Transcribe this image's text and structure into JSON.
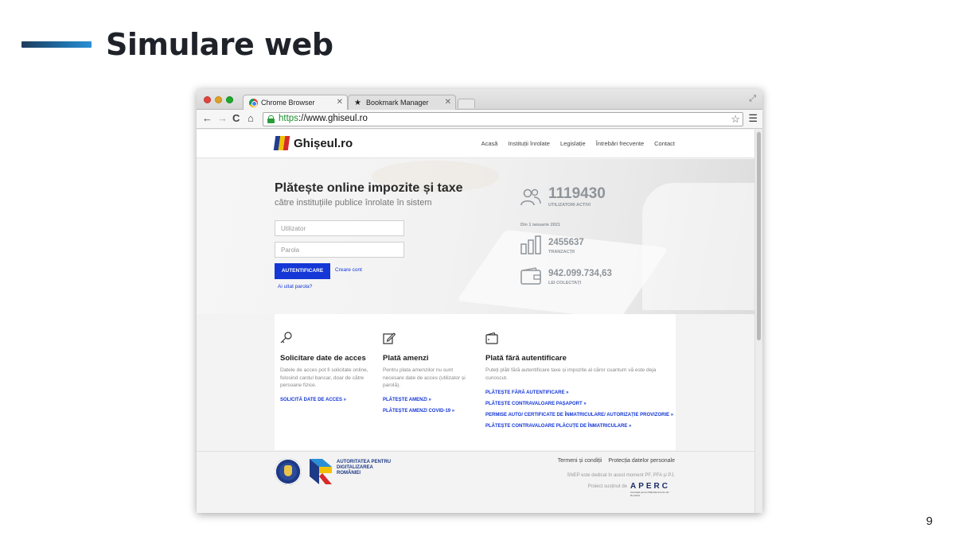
{
  "slide": {
    "title": "Simulare web",
    "page_number": "9"
  },
  "browser": {
    "tabs": [
      {
        "label": "Chrome Browser",
        "icon": "chrome-icon",
        "active": true
      },
      {
        "label": "Bookmark Manager",
        "icon": "star-icon",
        "active": false
      }
    ],
    "address": {
      "scheme": "https",
      "rest": "://www.ghiseul.ro"
    }
  },
  "site": {
    "logo_text": "Ghișeul.ro",
    "nav": [
      "Acasă",
      "Instituții înrolate",
      "Legislație",
      "Întrebări frecvente",
      "Contact"
    ],
    "hero": {
      "title": "Plătește online impozite și taxe",
      "subtitle": "către instituțiile publice înrolate în sistem",
      "username_placeholder": "Utilizator",
      "password_placeholder": "Parola",
      "login_button": "AUTENTIFICARE",
      "create_account": "Creare cont",
      "forgot_password": "Ai uitat parola?"
    },
    "stats": {
      "active_users_value": "1119430",
      "active_users_label": "UTILIZATORI ACTIVI",
      "since": "Din 1 ianuarie 2021",
      "transactions_value": "2455637",
      "transactions_label": "TRANZACȚII",
      "collected_value": "942.099.734,63",
      "collected_label": "LEI COLECTAȚI"
    },
    "cards": [
      {
        "icon": "key-icon",
        "title": "Solicitare date de acces",
        "description": "Datele de acces pot fi solicitate online, folosind cardul bancar, doar de către persoane fizice.",
        "links": [
          "SOLICITĂ DATE DE ACCES »"
        ]
      },
      {
        "icon": "edit-icon",
        "title": "Plată amenzi",
        "description": "Pentru plata amenzilor nu sunt necesare date de acces (utilizator și parolă).",
        "links": [
          "PLĂTEȘTE AMENZI »",
          "PLĂTEȘTE AMENZI COVID-19 »"
        ]
      },
      {
        "icon": "wallet-icon",
        "title": "Plată fără autentificare",
        "description": "Puteți plăti fără autentificare taxe și impozite al căror cuantum vă este deja cunoscut.",
        "links": [
          "PLĂTEȘTE FĂRĂ AUTENTIFICARE »",
          "PLĂTEȘTE CONTRAVALOARE PAȘAPORT »",
          "PERMISE AUTO/ CERTIFICATE DE ÎNMATRICULARE/ AUTORIZAȚIE PROVIZORIE »",
          "PLĂTEȘTE CONTRAVALOARE PLĂCUȚE DE ÎNMATRICULARE »"
        ]
      }
    ],
    "footer": {
      "adr_name": "AUTORITATEA PENTRU DIGITALIZAREA ROMÂNIEI",
      "links": [
        "Termeni și condiții",
        "Protecția datelor personale"
      ],
      "note": "SNEP este dedicat în acest moment PF, PFA și PJ.",
      "sponsor": "Proiect susținut de",
      "aperc": "APERC",
      "aperc_sub": "Asociația pentru Plăți Electronice din România"
    }
  },
  "colors": {
    "primary_button": "#1437d6",
    "link": "#1437d6",
    "stat_gray": "#8e949a"
  }
}
